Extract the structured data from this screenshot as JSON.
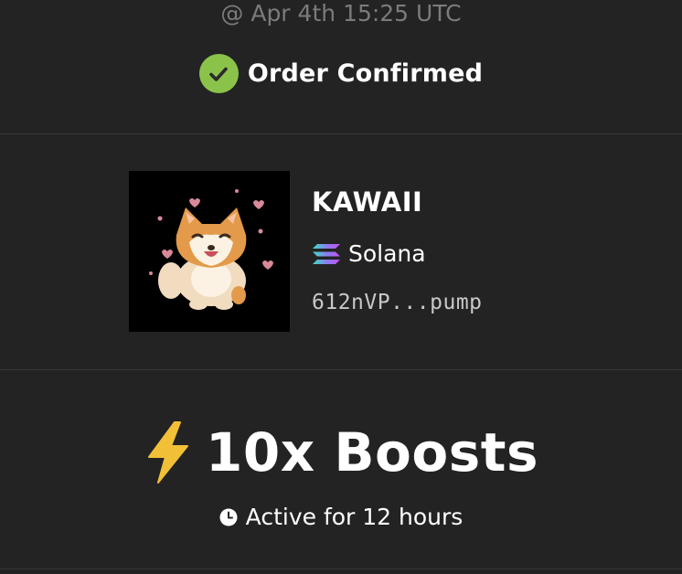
{
  "order": {
    "timestamp": "@ Apr 4th 15:25 UTC",
    "status": "Order Confirmed",
    "status_icon": "check-circle-icon",
    "status_color": "#8bc34a"
  },
  "token": {
    "name": "KAWAII",
    "image_icon": "shiba-dog-avatar",
    "chain": "Solana",
    "chain_icon": "solana-icon",
    "address": "612nVP...pump"
  },
  "boost": {
    "icon": "lightning-bolt-icon",
    "icon_color": "#f2c037",
    "label": "10x Boosts",
    "duration_icon": "clock-icon",
    "duration": "Active for 12 hours"
  },
  "colors": {
    "background": "#232324",
    "divider": "#38383a",
    "muted_text": "#7b7b7d"
  }
}
